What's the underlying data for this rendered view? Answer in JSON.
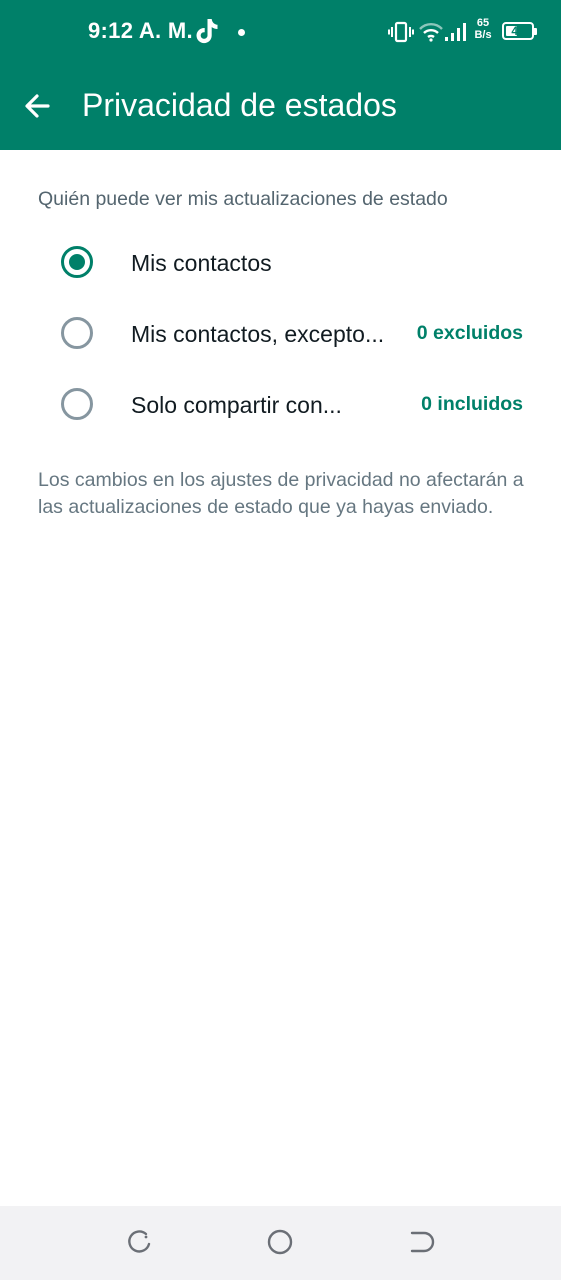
{
  "status_bar": {
    "time": "9:12 A. M.",
    "network_speed_value": "65",
    "network_speed_unit": "B/s",
    "battery_level": "46",
    "icons": [
      "tiktok-icon",
      "notification-dot-icon",
      "vibrate-icon",
      "wifi-icon",
      "signal-icon",
      "battery-icon"
    ]
  },
  "header": {
    "back_icon": "arrow-left-icon",
    "title": "Privacidad de estados"
  },
  "section": {
    "title": "Quién puede ver mis actualizaciones de estado"
  },
  "options": [
    {
      "label": "Mis contactos",
      "count": "",
      "selected": true
    },
    {
      "label": "Mis contactos, excepto...",
      "count": "0 excluidos",
      "selected": false
    },
    {
      "label": "Solo compartir con...",
      "count": "0 incluidos",
      "selected": false
    }
  ],
  "note": "Los cambios en los ajustes de privacidad no afectarán a las actualizaciones de estado que ya hayas enviado.",
  "nav_bar": {
    "buttons": [
      "recents-icon",
      "home-icon",
      "back-icon"
    ]
  },
  "colors": {
    "accent": "#008069",
    "background": "#ffffff",
    "primary_text": "#111b21",
    "secondary_text": "#667781",
    "radio_unselected": "#8696a0",
    "nav_bar": "#f2f2f4"
  }
}
